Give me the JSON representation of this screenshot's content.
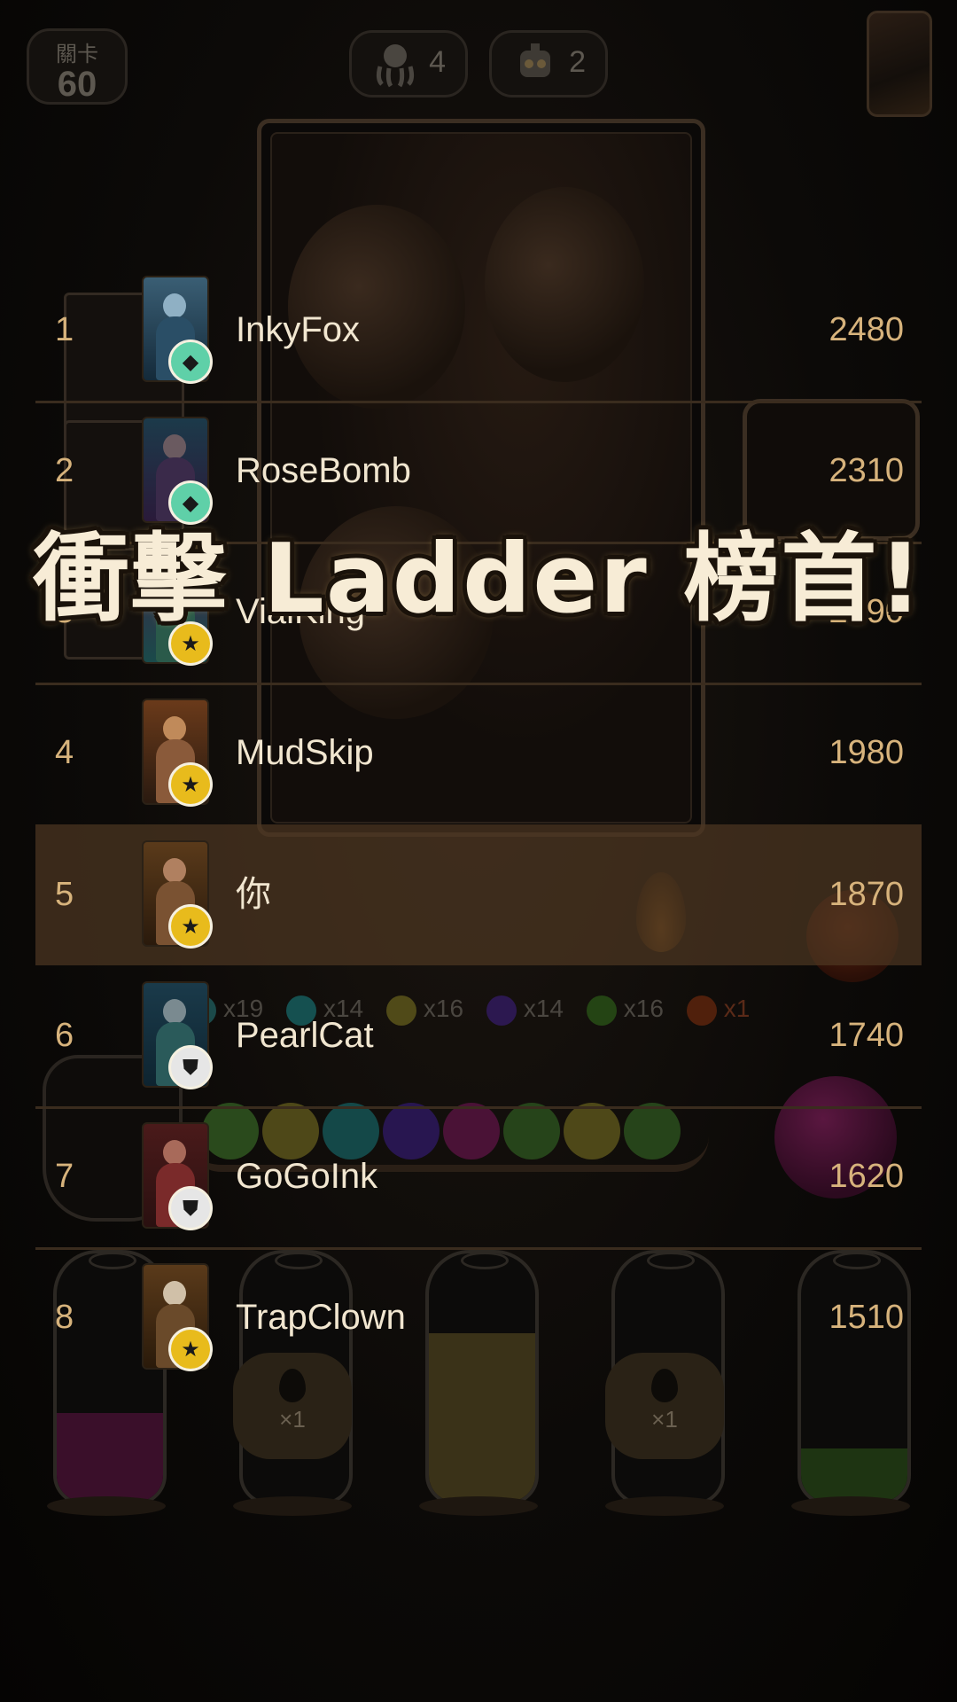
{
  "hud": {
    "level_label": "關卡",
    "level_value": "60",
    "counter_a": "4",
    "counter_b": "2"
  },
  "ball_counts": [
    {
      "color": "#2a7a7a",
      "count": "x19"
    },
    {
      "color": "#1f6b6b",
      "count": "x14"
    },
    {
      "color": "#6b6220",
      "count": "x16"
    },
    {
      "color": "#3a1f6b",
      "count": "x14"
    },
    {
      "color": "#2f5a1a",
      "count": "x16"
    },
    {
      "color": "#6a2a10",
      "count": "x1"
    }
  ],
  "drop_badges": [
    "×1",
    "×1"
  ],
  "headline": "衝擊 Ladder 榜首!",
  "leaderboard": [
    {
      "rank": "1",
      "name": "InkyFox",
      "score": "2480",
      "tier": "diamond",
      "tier_icon": "diamond-icon"
    },
    {
      "rank": "2",
      "name": "RoseBomb",
      "score": "2310",
      "tier": "diamond",
      "tier_icon": "diamond-icon"
    },
    {
      "rank": "3",
      "name": "VialKing",
      "score": "2190",
      "tier": "gold",
      "tier_icon": "star-icon"
    },
    {
      "rank": "4",
      "name": "MudSkip",
      "score": "1980",
      "tier": "gold",
      "tier_icon": "star-icon"
    },
    {
      "rank": "5",
      "name": "你",
      "score": "1870",
      "tier": "gold",
      "tier_icon": "star-icon",
      "is_you": true
    },
    {
      "rank": "6",
      "name": "PearlCat",
      "score": "1740",
      "tier": "silver",
      "tier_icon": "shield-icon"
    },
    {
      "rank": "7",
      "name": "GoGoInk",
      "score": "1620",
      "tier": "silver",
      "tier_icon": "shield-icon"
    },
    {
      "rank": "8",
      "name": "TrapClown",
      "score": "1510",
      "tier": "gold",
      "tier_icon": "star-icon"
    }
  ],
  "colors": {
    "rank_text": "#d7b37c",
    "name_text": "#f1e6d0",
    "highlight_row": "#4e3822",
    "diamond_badge": "#5fd0a8",
    "gold_badge": "#e8bb1c",
    "silver_badge": "#e6e6e6"
  }
}
